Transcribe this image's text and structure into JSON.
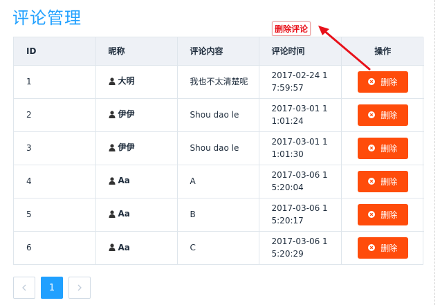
{
  "page": {
    "title": "评论管理"
  },
  "annotation": {
    "label": "删除评论",
    "color": "#e8111a"
  },
  "table": {
    "headers": [
      "ID",
      "昵称",
      "评论内容",
      "评论时间",
      "操作"
    ],
    "delete_label": "删除",
    "rows": [
      {
        "id": "1",
        "nickname": "大明",
        "content": "我也不太清楚呢",
        "time": "2017-02-24 17:59:57"
      },
      {
        "id": "2",
        "nickname": "伊伊",
        "content": "Shou dao le",
        "time": "2017-03-01 11:01:24"
      },
      {
        "id": "3",
        "nickname": "伊伊",
        "content": "Shou dao le",
        "time": "2017-03-01 11:01:30"
      },
      {
        "id": "4",
        "nickname": "Aa",
        "content": "A",
        "time": "2017-03-06 15:20:04"
      },
      {
        "id": "5",
        "nickname": "Aa",
        "content": "B",
        "time": "2017-03-06 15:20:17"
      },
      {
        "id": "6",
        "nickname": "Aa",
        "content": "C",
        "time": "2017-03-06 15:20:29"
      }
    ]
  },
  "pagination": {
    "current": "1",
    "prev_icon": "chevron-left-icon",
    "next_icon": "chevron-right-icon"
  },
  "colors": {
    "accent": "#20a0ff",
    "danger": "#ff4c0b",
    "header_bg": "#eef1f6"
  }
}
